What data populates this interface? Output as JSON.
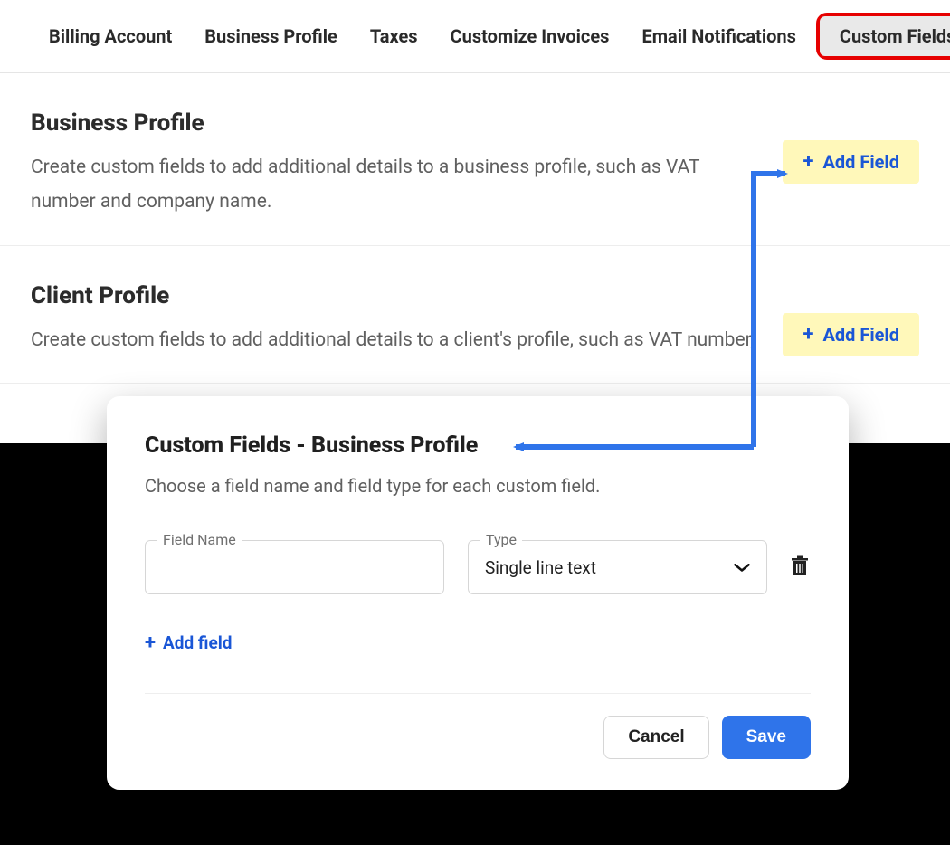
{
  "tabs": {
    "items": [
      {
        "label": "Billing Account"
      },
      {
        "label": "Business Profile"
      },
      {
        "label": "Taxes"
      },
      {
        "label": "Customize Invoices"
      },
      {
        "label": "Email Notifications"
      },
      {
        "label": "Custom Fields"
      }
    ]
  },
  "sections": {
    "business": {
      "title": "Business Profile",
      "desc": "Create custom fields to add additional details to a business profile, such as VAT number and company name.",
      "add_label": "Add Field"
    },
    "client": {
      "title": "Client Profile",
      "desc": "Create custom fields to add additional details to a client's profile, such as VAT number,",
      "add_label": "Add Field"
    }
  },
  "modal": {
    "title": "Custom Fields - Business Profile",
    "desc": "Choose a field name and field type for each custom field.",
    "field_name_label": "Field Name",
    "field_name_value": "",
    "type_label": "Type",
    "type_value": "Single line text",
    "add_field_label": "Add field",
    "cancel_label": "Cancel",
    "save_label": "Save"
  },
  "colors": {
    "accent": "#1a56d6",
    "highlight_yellow": "#fff8ba",
    "annotation": "#2f74ea"
  }
}
